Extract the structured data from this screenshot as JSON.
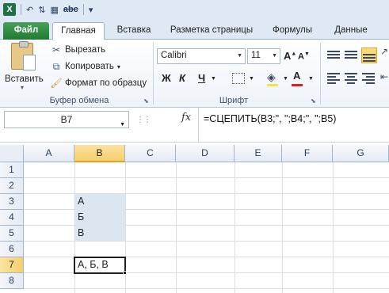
{
  "tabs": {
    "file": "Файл",
    "home": "Главная",
    "insert": "Вставка",
    "layout": "Разметка страницы",
    "formulas": "Формулы",
    "data": "Данные"
  },
  "clipboard": {
    "paste": "Вставить",
    "cut": "Вырезать",
    "copy": "Копировать",
    "format_painter": "Формат по образцу",
    "group_label": "Буфер обмена"
  },
  "font": {
    "name": "Calibri",
    "size": "11",
    "bold": "Ж",
    "italic": "К",
    "underline": "Ч",
    "grow": "A",
    "shrink": "A",
    "color_letter": "A",
    "group_label": "Шрифт"
  },
  "formula_bar": {
    "name_box": "B7",
    "fx": "fx",
    "formula": "=СЦЕПИТЬ(B3;\", \";B4;\", \";B5)"
  },
  "grid": {
    "columns": [
      "A",
      "B",
      "C",
      "D",
      "E",
      "F",
      "G"
    ],
    "selected_column": "B",
    "rows": [
      "1",
      "2",
      "3",
      "4",
      "5",
      "6",
      "7",
      "8"
    ],
    "selected_row": "7",
    "cells": {
      "B3": "А",
      "B4": "Б",
      "B5": "В",
      "B7": "А, Б, В"
    }
  },
  "colors": {
    "ribbon_bg": "#dfe8f5",
    "file_tab": "#1f7a33",
    "selection_highlight": "#dce6f1",
    "header_selected": "#f7cf6c",
    "font_color_accent": "#e02020"
  }
}
